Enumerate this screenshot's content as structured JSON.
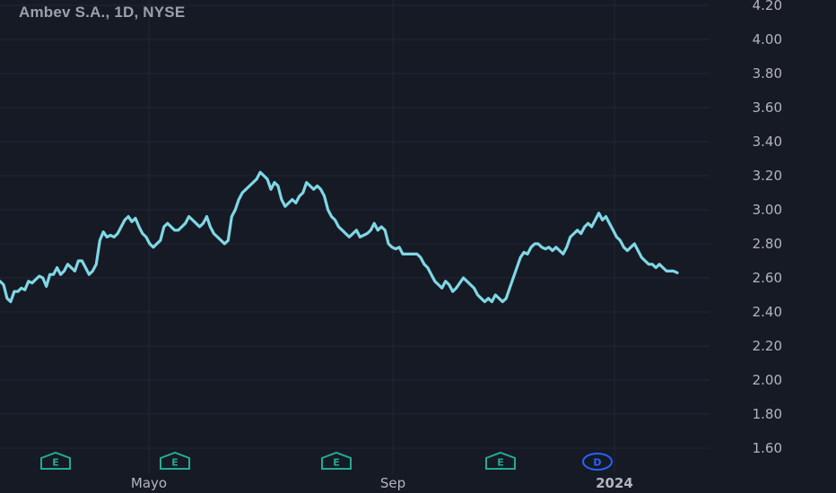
{
  "title": "Ambev S.A., 1D, NYSE",
  "colors": {
    "background": "#161a25",
    "grid": "#232733",
    "line": "#7fd7e5",
    "text": "#b2b5be",
    "earnings": "#22ab94",
    "dividend": "#2962ff"
  },
  "chart_data": {
    "type": "line",
    "title": "Ambev S.A., 1D, NYSE",
    "ylim": [
      1.6,
      4.2
    ],
    "yticks": [
      "4.20",
      "4.00",
      "3.80",
      "3.60",
      "3.40",
      "3.20",
      "3.00",
      "2.80",
      "2.60",
      "2.40",
      "2.20",
      "2.00",
      "1.80",
      "1.60"
    ],
    "xticks": [
      {
        "label": "Mayo",
        "bold": false
      },
      {
        "label": "Sep",
        "bold": false
      },
      {
        "label": "2024",
        "bold": true
      }
    ],
    "grid": true,
    "events": [
      {
        "type": "earnings",
        "label": "E"
      },
      {
        "type": "earnings",
        "label": "E"
      },
      {
        "type": "earnings",
        "label": "E"
      },
      {
        "type": "earnings",
        "label": "E"
      },
      {
        "type": "dividend",
        "label": "D"
      }
    ],
    "series": [
      {
        "values": [
          2.58,
          2.56,
          2.48,
          2.46,
          2.52,
          2.52,
          2.54,
          2.53,
          2.58,
          2.57,
          2.59,
          2.61,
          2.6,
          2.55,
          2.62,
          2.62,
          2.66,
          2.62,
          2.64,
          2.68,
          2.66,
          2.64,
          2.7,
          2.7,
          2.66,
          2.62,
          2.64,
          2.68,
          2.82,
          2.87,
          2.84,
          2.85,
          2.84,
          2.86,
          2.9,
          2.94,
          2.96,
          2.93,
          2.95,
          2.9,
          2.86,
          2.84,
          2.8,
          2.78,
          2.8,
          2.82,
          2.9,
          2.92,
          2.9,
          2.88,
          2.88,
          2.9,
          2.92,
          2.96,
          2.94,
          2.92,
          2.9,
          2.92,
          2.96,
          2.9,
          2.86,
          2.84,
          2.82,
          2.8,
          2.82,
          2.96,
          3.0,
          3.06,
          3.1,
          3.12,
          3.14,
          3.16,
          3.18,
          3.22,
          3.2,
          3.18,
          3.12,
          3.16,
          3.14,
          3.06,
          3.02,
          3.04,
          3.06,
          3.04,
          3.08,
          3.1,
          3.16,
          3.14,
          3.12,
          3.14,
          3.12,
          3.08,
          3.0,
          2.96,
          2.94,
          2.9,
          2.88,
          2.86,
          2.84,
          2.86,
          2.88,
          2.84,
          2.85,
          2.86,
          2.88,
          2.92,
          2.88,
          2.9,
          2.88,
          2.8,
          2.78,
          2.77,
          2.78,
          2.74,
          2.74,
          2.74,
          2.74,
          2.74,
          2.72,
          2.68,
          2.66,
          2.62,
          2.58,
          2.56,
          2.54,
          2.58,
          2.56,
          2.52,
          2.54,
          2.57,
          2.6,
          2.58,
          2.56,
          2.54,
          2.5,
          2.48,
          2.46,
          2.48,
          2.46,
          2.5,
          2.48,
          2.46,
          2.48,
          2.54,
          2.6,
          2.66,
          2.72,
          2.75,
          2.74,
          2.78,
          2.8,
          2.8,
          2.78,
          2.77,
          2.78,
          2.76,
          2.78,
          2.76,
          2.74,
          2.78,
          2.84,
          2.86,
          2.88,
          2.86,
          2.9,
          2.92,
          2.9,
          2.94,
          2.98,
          2.94,
          2.96,
          2.92,
          2.88,
          2.84,
          2.82,
          2.78,
          2.76,
          2.78,
          2.8,
          2.76,
          2.72,
          2.7,
          2.68,
          2.68,
          2.66,
          2.68,
          2.66,
          2.64,
          2.64,
          2.64,
          2.63
        ]
      }
    ]
  }
}
